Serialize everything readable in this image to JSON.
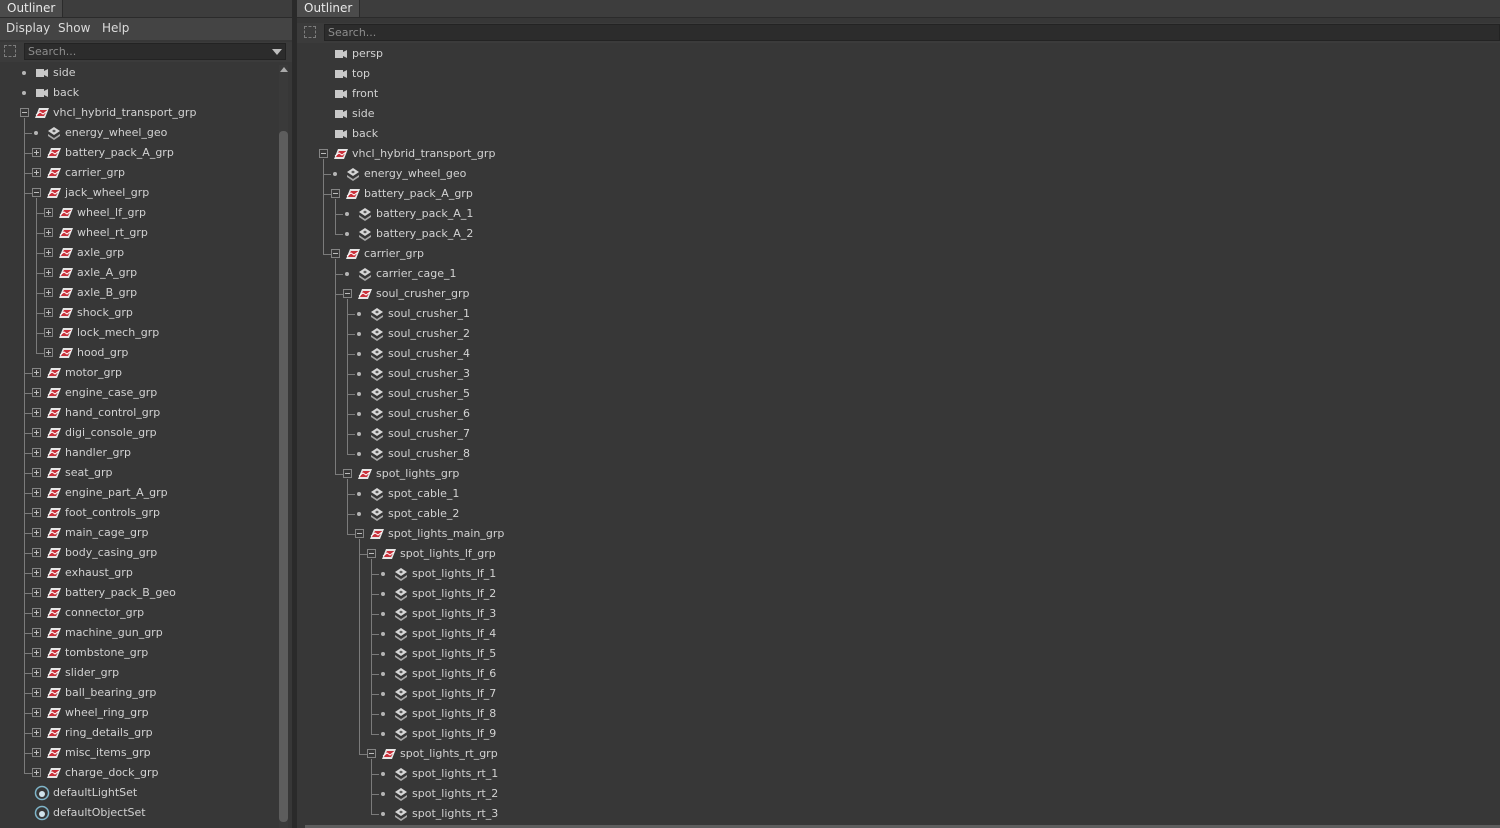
{
  "left_panel": {
    "tab": "Outliner",
    "menu": [
      "Display",
      "Show",
      "Help"
    ],
    "search_placeholder": "Search...",
    "items": [
      {
        "label": "side",
        "icon": "camera",
        "depth": 1,
        "node": "dot"
      },
      {
        "label": "back",
        "icon": "camera",
        "depth": 1,
        "node": "dot"
      },
      {
        "label": "vhcl_hybrid_transport_grp",
        "icon": "group",
        "depth": 1,
        "node": "minus"
      },
      {
        "label": "energy_wheel_geo",
        "icon": "mesh",
        "depth": 2,
        "node": "dot"
      },
      {
        "label": "battery_pack_A_grp",
        "icon": "group",
        "depth": 2,
        "node": "plus"
      },
      {
        "label": "carrier_grp",
        "icon": "group",
        "depth": 2,
        "node": "plus"
      },
      {
        "label": "jack_wheel_grp",
        "icon": "group",
        "depth": 2,
        "node": "minus"
      },
      {
        "label": "wheel_lf_grp",
        "icon": "group",
        "depth": 3,
        "node": "plus"
      },
      {
        "label": "wheel_rt_grp",
        "icon": "group",
        "depth": 3,
        "node": "plus"
      },
      {
        "label": "axle_grp",
        "icon": "group",
        "depth": 3,
        "node": "plus"
      },
      {
        "label": "axle_A_grp",
        "icon": "group",
        "depth": 3,
        "node": "plus"
      },
      {
        "label": "axle_B_grp",
        "icon": "group",
        "depth": 3,
        "node": "plus"
      },
      {
        "label": "shock_grp",
        "icon": "group",
        "depth": 3,
        "node": "plus"
      },
      {
        "label": "lock_mech_grp",
        "icon": "group",
        "depth": 3,
        "node": "plus"
      },
      {
        "label": "hood_grp",
        "icon": "group",
        "depth": 3,
        "node": "plus"
      },
      {
        "label": "motor_grp",
        "icon": "group",
        "depth": 2,
        "node": "plus"
      },
      {
        "label": "engine_case_grp",
        "icon": "group",
        "depth": 2,
        "node": "plus"
      },
      {
        "label": "hand_control_grp",
        "icon": "group",
        "depth": 2,
        "node": "plus"
      },
      {
        "label": "digi_console_grp",
        "icon": "group",
        "depth": 2,
        "node": "plus"
      },
      {
        "label": "handler_grp",
        "icon": "group",
        "depth": 2,
        "node": "plus"
      },
      {
        "label": "seat_grp",
        "icon": "group",
        "depth": 2,
        "node": "plus"
      },
      {
        "label": "engine_part_A_grp",
        "icon": "group",
        "depth": 2,
        "node": "plus"
      },
      {
        "label": "foot_controls_grp",
        "icon": "group",
        "depth": 2,
        "node": "plus"
      },
      {
        "label": "main_cage_grp",
        "icon": "group",
        "depth": 2,
        "node": "plus"
      },
      {
        "label": "body_casing_grp",
        "icon": "group",
        "depth": 2,
        "node": "plus"
      },
      {
        "label": "exhaust_grp",
        "icon": "group",
        "depth": 2,
        "node": "plus"
      },
      {
        "label": "battery_pack_B_geo",
        "icon": "group",
        "depth": 2,
        "node": "plus"
      },
      {
        "label": "connector_grp",
        "icon": "group",
        "depth": 2,
        "node": "plus"
      },
      {
        "label": "machine_gun_grp",
        "icon": "group",
        "depth": 2,
        "node": "plus"
      },
      {
        "label": "tombstone_grp",
        "icon": "group",
        "depth": 2,
        "node": "plus"
      },
      {
        "label": "slider_grp",
        "icon": "group",
        "depth": 2,
        "node": "plus"
      },
      {
        "label": "ball_bearing_grp",
        "icon": "group",
        "depth": 2,
        "node": "plus"
      },
      {
        "label": "wheel_ring_grp",
        "icon": "group",
        "depth": 2,
        "node": "plus"
      },
      {
        "label": "ring_details_grp",
        "icon": "group",
        "depth": 2,
        "node": "plus"
      },
      {
        "label": "misc_items_grp",
        "icon": "group",
        "depth": 2,
        "node": "plus"
      },
      {
        "label": "charge_dock_grp",
        "icon": "group",
        "depth": 2,
        "node": "plus"
      },
      {
        "label": "defaultLightSet",
        "icon": "set",
        "depth": 1,
        "node": "none"
      },
      {
        "label": "defaultObjectSet",
        "icon": "set",
        "depth": 1,
        "node": "none"
      }
    ]
  },
  "right_panel": {
    "tab": "Outliner",
    "search_placeholder": "Search...",
    "items": [
      {
        "label": "persp",
        "icon": "camera",
        "depth": 1,
        "node": "none"
      },
      {
        "label": "top",
        "icon": "camera",
        "depth": 1,
        "node": "none"
      },
      {
        "label": "front",
        "icon": "camera",
        "depth": 1,
        "node": "none"
      },
      {
        "label": "side",
        "icon": "camera",
        "depth": 1,
        "node": "none"
      },
      {
        "label": "back",
        "icon": "camera",
        "depth": 1,
        "node": "none"
      },
      {
        "label": "vhcl_hybrid_transport_grp",
        "icon": "group",
        "depth": 1,
        "node": "minus"
      },
      {
        "label": "energy_wheel_geo",
        "icon": "mesh",
        "depth": 2,
        "node": "dot"
      },
      {
        "label": "battery_pack_A_grp",
        "icon": "group",
        "depth": 2,
        "node": "minus"
      },
      {
        "label": "battery_pack_A_1",
        "icon": "mesh",
        "depth": 3,
        "node": "dot"
      },
      {
        "label": "battery_pack_A_2",
        "icon": "mesh",
        "depth": 3,
        "node": "dot"
      },
      {
        "label": "carrier_grp",
        "icon": "group",
        "depth": 2,
        "node": "minus"
      },
      {
        "label": "carrier_cage_1",
        "icon": "mesh",
        "depth": 3,
        "node": "dot"
      },
      {
        "label": "soul_crusher_grp",
        "icon": "group",
        "depth": 3,
        "node": "minus"
      },
      {
        "label": "soul_crusher_1",
        "icon": "mesh",
        "depth": 4,
        "node": "dot"
      },
      {
        "label": "soul_crusher_2",
        "icon": "mesh",
        "depth": 4,
        "node": "dot"
      },
      {
        "label": "soul_crusher_4",
        "icon": "mesh",
        "depth": 4,
        "node": "dot"
      },
      {
        "label": "soul_crusher_3",
        "icon": "mesh",
        "depth": 4,
        "node": "dot"
      },
      {
        "label": "soul_crusher_5",
        "icon": "mesh",
        "depth": 4,
        "node": "dot"
      },
      {
        "label": "soul_crusher_6",
        "icon": "mesh",
        "depth": 4,
        "node": "dot"
      },
      {
        "label": "soul_crusher_7",
        "icon": "mesh",
        "depth": 4,
        "node": "dot"
      },
      {
        "label": "soul_crusher_8",
        "icon": "mesh",
        "depth": 4,
        "node": "dot"
      },
      {
        "label": "spot_lights_grp",
        "icon": "group",
        "depth": 3,
        "node": "minus"
      },
      {
        "label": "spot_cable_1",
        "icon": "mesh",
        "depth": 4,
        "node": "dot"
      },
      {
        "label": "spot_cable_2",
        "icon": "mesh",
        "depth": 4,
        "node": "dot"
      },
      {
        "label": "spot_lights_main_grp",
        "icon": "group",
        "depth": 4,
        "node": "minus"
      },
      {
        "label": "spot_lights_lf_grp",
        "icon": "group",
        "depth": 5,
        "node": "minus"
      },
      {
        "label": "spot_lights_lf_1",
        "icon": "mesh",
        "depth": 6,
        "node": "dot"
      },
      {
        "label": "spot_lights_lf_2",
        "icon": "mesh",
        "depth": 6,
        "node": "dot"
      },
      {
        "label": "spot_lights_lf_3",
        "icon": "mesh",
        "depth": 6,
        "node": "dot"
      },
      {
        "label": "spot_lights_lf_4",
        "icon": "mesh",
        "depth": 6,
        "node": "dot"
      },
      {
        "label": "spot_lights_lf_5",
        "icon": "mesh",
        "depth": 6,
        "node": "dot"
      },
      {
        "label": "spot_lights_lf_6",
        "icon": "mesh",
        "depth": 6,
        "node": "dot"
      },
      {
        "label": "spot_lights_lf_7",
        "icon": "mesh",
        "depth": 6,
        "node": "dot"
      },
      {
        "label": "spot_lights_lf_8",
        "icon": "mesh",
        "depth": 6,
        "node": "dot"
      },
      {
        "label": "spot_lights_lf_9",
        "icon": "mesh",
        "depth": 6,
        "node": "dot"
      },
      {
        "label": "spot_lights_rt_grp",
        "icon": "group",
        "depth": 5,
        "node": "minus"
      },
      {
        "label": "spot_lights_rt_1",
        "icon": "mesh",
        "depth": 6,
        "node": "dot"
      },
      {
        "label": "spot_lights_rt_2",
        "icon": "mesh",
        "depth": 6,
        "node": "dot"
      },
      {
        "label": "spot_lights_rt_3",
        "icon": "mesh",
        "depth": 6,
        "node": "dot"
      }
    ]
  }
}
